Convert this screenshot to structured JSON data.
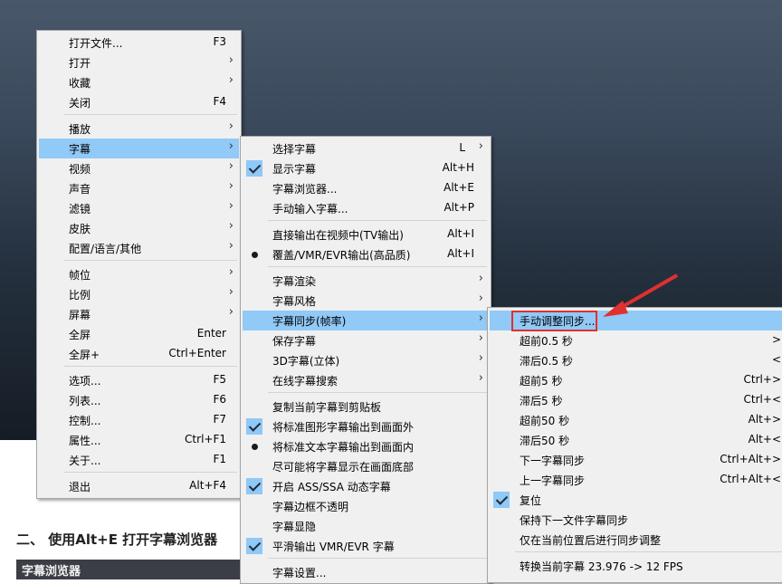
{
  "menu1": {
    "items": [
      {
        "label": "打开文件...",
        "shortcut": "F3"
      },
      {
        "label": "打开",
        "arrow": true
      },
      {
        "label": "收藏",
        "arrow": true
      },
      {
        "label": "关闭",
        "shortcut": "F4"
      },
      {
        "label": "播放",
        "arrow": true
      },
      {
        "label": "字幕",
        "arrow": true
      },
      {
        "label": "视频",
        "arrow": true
      },
      {
        "label": "声音",
        "arrow": true
      },
      {
        "label": "滤镜",
        "arrow": true
      },
      {
        "label": "皮肤",
        "arrow": true
      },
      {
        "label": "配置/语言/其他",
        "arrow": true
      },
      {
        "label": "帧位",
        "arrow": true
      },
      {
        "label": "比例",
        "arrow": true
      },
      {
        "label": "屏幕",
        "arrow": true
      },
      {
        "label": "全屏",
        "shortcut": "Enter"
      },
      {
        "label": "全屏+",
        "shortcut": "Ctrl+Enter"
      },
      {
        "label": "选项...",
        "shortcut": "F5"
      },
      {
        "label": "列表...",
        "shortcut": "F6"
      },
      {
        "label": "控制...",
        "shortcut": "F7"
      },
      {
        "label": "属性...",
        "shortcut": "Ctrl+F1"
      },
      {
        "label": "关于...",
        "shortcut": "F1"
      },
      {
        "label": "退出",
        "shortcut": "Alt+F4"
      }
    ]
  },
  "menu2": {
    "items": [
      {
        "label": "选择字幕",
        "shortcut": "L"
      },
      {
        "label": "显示字幕",
        "shortcut": "Alt+H"
      },
      {
        "label": "字幕浏览器...",
        "shortcut": "Alt+E"
      },
      {
        "label": "手动输入字幕...",
        "shortcut": "Alt+P"
      },
      {
        "label": "直接输出在视频中(TV输出)",
        "shortcut": "Alt+I"
      },
      {
        "label": "覆盖/VMR/EVR输出(高品质)",
        "shortcut": "Alt+I"
      },
      {
        "label": "字幕渲染"
      },
      {
        "label": "字幕风格"
      },
      {
        "label": "字幕同步(帧率)"
      },
      {
        "label": "保存字幕"
      },
      {
        "label": "3D字幕(立体)"
      },
      {
        "label": "在线字幕搜索"
      },
      {
        "label": "复制当前字幕到剪贴板"
      },
      {
        "label": "将标准图形字幕输出到画面外"
      },
      {
        "label": "将标准文本字幕输出到画面内"
      },
      {
        "label": "尽可能将字幕显示在画面底部"
      },
      {
        "label": "开启 ASS/SSA 动态字幕"
      },
      {
        "label": "字幕边框不透明"
      },
      {
        "label": "字幕显隐"
      },
      {
        "label": "平滑输出 VMR/EVR 字幕"
      },
      {
        "label": "字幕设置..."
      }
    ]
  },
  "menu3": {
    "items": [
      {
        "label": "手动调整同步..."
      },
      {
        "label": "超前0.5 秒",
        "shortcut": ">"
      },
      {
        "label": "滞后0.5 秒",
        "shortcut": "<"
      },
      {
        "label": "超前5 秒",
        "shortcut": "Ctrl+>"
      },
      {
        "label": "滞后5 秒",
        "shortcut": "Ctrl+<"
      },
      {
        "label": "超前50 秒",
        "shortcut": "Alt+>"
      },
      {
        "label": "滞后50 秒",
        "shortcut": "Alt+<"
      },
      {
        "label": "下一字幕同步",
        "shortcut": "Ctrl+Alt+>"
      },
      {
        "label": "上一字幕同步",
        "shortcut": "Ctrl+Alt+<"
      },
      {
        "label": "复位"
      },
      {
        "label": "保持下一文件字幕同步"
      },
      {
        "label": "仅在当前位置后进行同步调整"
      },
      {
        "label": "转换当前字幕 23.976 -> 12 FPS"
      }
    ]
  },
  "article": {
    "heading": "二、 使用Alt+E 打开字幕浏览器",
    "strip": "字幕浏览器"
  },
  "colors": {
    "highlight": "#91c9f7",
    "menu_bg": "#f0f0f0",
    "annotation": "#e0302f"
  }
}
